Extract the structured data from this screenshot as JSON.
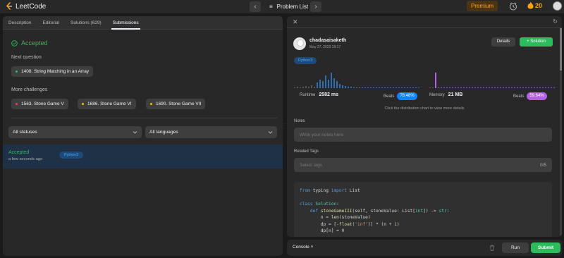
{
  "topbar": {
    "logo_text": "LeetCode",
    "problem_list_label": "Problem List",
    "premium_label": "Premium",
    "streak_count": "20"
  },
  "tabs": [
    {
      "label": "Description"
    },
    {
      "label": "Editorial"
    },
    {
      "label": "Solutions (629)"
    },
    {
      "label": "Submissions"
    }
  ],
  "result": {
    "status": "Accepted",
    "next_question_label": "Next question",
    "next_question": "1408. String Matching in an Array",
    "more_challenges_label": "More challenges",
    "challenges": [
      {
        "title": "1563. Stone Game V",
        "color": "#ff375f"
      },
      {
        "title": "1686. Stone Game VI",
        "color": "#ffb800"
      },
      {
        "title": "1690. Stone Game VII",
        "color": "#ffb800"
      }
    ]
  },
  "filters": {
    "status_select": "All statuses",
    "language_select": "All languages"
  },
  "submissions": [
    {
      "status": "Accepted",
      "time": "a few seconds ago",
      "language": "Python3"
    }
  ],
  "detail": {
    "username": "chadasaisaketh",
    "date": "May 27, 2023 19:17",
    "details_label": "Details",
    "solution_label": "Solution",
    "language": "Python3",
    "runtime_label": "Runtime",
    "runtime_value": "2582 ms",
    "runtime_beats_label": "Beats",
    "runtime_beats": "78.48%",
    "memory_label": "Memory",
    "memory_value": "21 MB",
    "memory_beats_label": "Beats",
    "memory_beats": "59.64%",
    "chart_hint": "Click the distribution chart to view more details",
    "notes_label": "Notes",
    "notes_placeholder": "Write your notes here",
    "tags_label": "Related Tags",
    "tags_placeholder": "Select tags",
    "tags_count": "0/5",
    "colors": {
      "runtime": "#0a84ff",
      "memory": "#b360e6",
      "accent": "#2cbb5d"
    }
  },
  "bottom": {
    "console_label": "Console",
    "run_label": "Run",
    "submit_label": "Submit"
  }
}
